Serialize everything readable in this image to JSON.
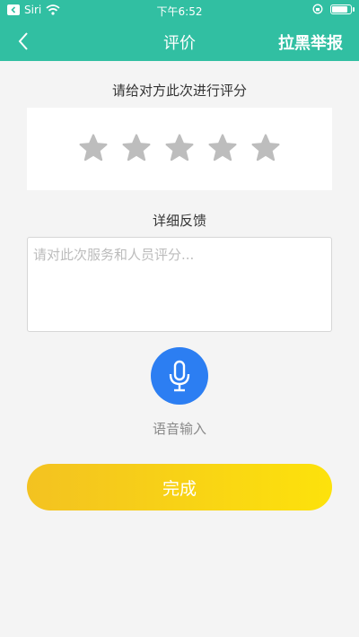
{
  "status_bar": {
    "carrier": "Siri",
    "time": "下午6:52",
    "icons": [
      "back-arrow-icon",
      "wifi-icon",
      "orientation-lock-icon",
      "battery-icon"
    ]
  },
  "nav": {
    "back_icon": "chevron-left-icon",
    "title": "评价",
    "report": "拉黑举报"
  },
  "rating": {
    "prompt": "请给对方此次进行评分",
    "max_stars": 5,
    "selected": 0,
    "star_color": "#bdbdbd"
  },
  "feedback": {
    "title": "详细反馈",
    "placeholder": "请对此次服务和人员评分...",
    "value": ""
  },
  "voice": {
    "icon": "microphone-icon",
    "label": "语音输入",
    "color": "#2c7ef2"
  },
  "done_button": {
    "label": "完成"
  },
  "colors": {
    "header": "#31bfa2",
    "background": "#f4f4f4",
    "button_gradient": [
      "#f3c221",
      "#fde20b"
    ]
  }
}
